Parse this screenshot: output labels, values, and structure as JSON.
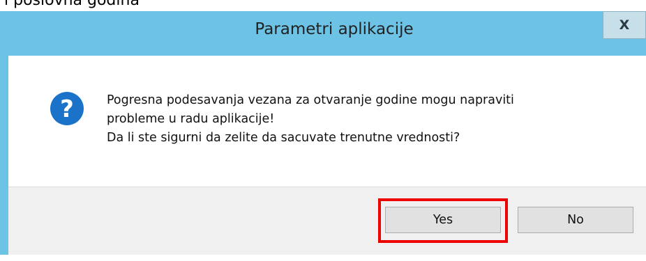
{
  "background": {
    "text": "i poslovna godina"
  },
  "dialog": {
    "title": "Parametri aplikacije",
    "close_glyph": "X",
    "icon": "question-icon",
    "message_lines": [
      "Pogresna podesavanja vezana za otvaranje godine mogu napraviti",
      "probleme u radu aplikacije!",
      "Da li ste sigurni da zelite da sacuvate trenutne vrednosti?"
    ],
    "buttons": {
      "yes_label": "Yes",
      "no_label": "No"
    },
    "highlighted_button": "Yes"
  },
  "colors": {
    "title_bar": "#6cc3e6",
    "icon_blue": "#1a73c9",
    "highlight_red": "#ee0000",
    "button_area": "#f0f0f0"
  }
}
